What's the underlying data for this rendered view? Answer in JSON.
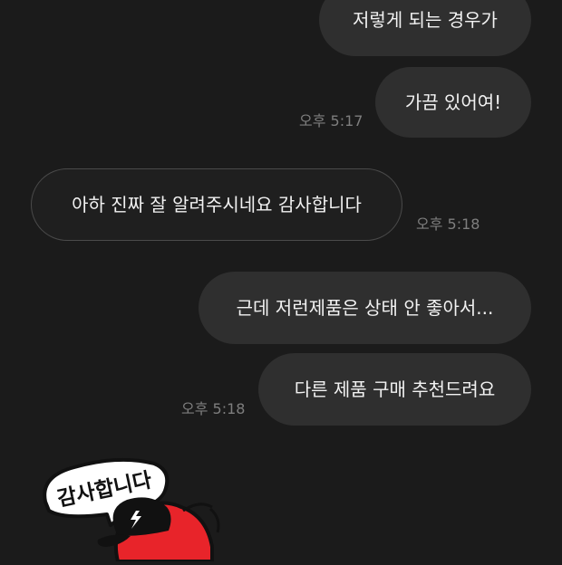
{
  "messages": [
    {
      "text": "저렇게 되는 경우가"
    },
    {
      "text": "가끔 있어여!"
    },
    {
      "text": "아하 진짜 잘 알려주시네요 감사합니다"
    },
    {
      "text": "근데 저런제품은 상태 안 좋아서..."
    },
    {
      "text": "다른 제품 구매 추천드려요"
    }
  ],
  "timestamps": {
    "sent_1": "오후 5:17",
    "received_1": "오후 5:18",
    "sent_2": "오후 5:18"
  },
  "sticker": {
    "text": "감사합니다",
    "icon": "thank-you-character-sticker"
  },
  "colors": {
    "background": "#1b1b1b",
    "sent_bubble": "#2f2f2f",
    "received_bubble": "#1f1f1f",
    "text": "#f2f2f2",
    "timestamp": "#7e7e7e",
    "sticker_red": "#e8242a"
  }
}
